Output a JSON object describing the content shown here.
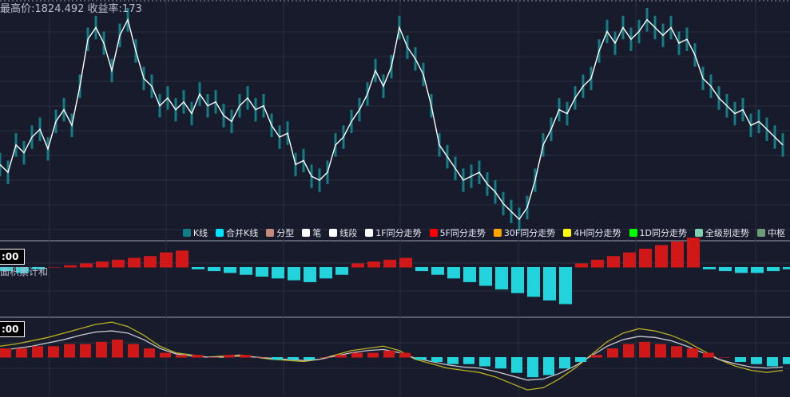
{
  "header": {
    "info_text": "最高价:1824.492 收益率:173"
  },
  "panels": {
    "macd_time": ":00",
    "macd_label": "面积累计和",
    "kdj_time": ":00"
  },
  "legend": [
    {
      "label": "K线",
      "color": "#127d86"
    },
    {
      "label": "合并K线",
      "color": "#00e5ff"
    },
    {
      "label": "分型",
      "color": "#c88a78"
    },
    {
      "label": "笔",
      "color": "#ffffff"
    },
    {
      "label": "线段",
      "color": "#ffffff"
    },
    {
      "label": "1F同分走势",
      "color": "#ffffff"
    },
    {
      "label": "5F同分走势",
      "color": "#ff0000"
    },
    {
      "label": "30F同分走势",
      "color": "#ffa500"
    },
    {
      "label": "4H同分走势",
      "color": "#ffff00"
    },
    {
      "label": "1D同分走势",
      "color": "#00ff00"
    },
    {
      "label": "全级别走势",
      "color": "#7fcfb0"
    },
    {
      "label": "中枢",
      "color": "#6f9a78"
    }
  ],
  "chart_data": [
    {
      "type": "line",
      "name": "price",
      "x": [
        0,
        10,
        20,
        30,
        40,
        50,
        60,
        70,
        80,
        90,
        100,
        110,
        120,
        130,
        140,
        150,
        160,
        170,
        180,
        190,
        200,
        210,
        220,
        230,
        240,
        250,
        260,
        270,
        280,
        290,
        300,
        310,
        320,
        330,
        340,
        350,
        360,
        370,
        380,
        390,
        400,
        410,
        420,
        430,
        440,
        450,
        460,
        470,
        480,
        490,
        500,
        510,
        520,
        530,
        540,
        550,
        560,
        570,
        580,
        590,
        600,
        610,
        620,
        630,
        640,
        650,
        660,
        670,
        680,
        690,
        700,
        710,
        720,
        730,
        740,
        750,
        760,
        770,
        780,
        790,
        800,
        810,
        820,
        830,
        840,
        850,
        860,
        870,
        880,
        890,
        900,
        910,
        920,
        930,
        940,
        950,
        960,
        970,
        980
      ],
      "values": [
        30,
        26,
        40,
        36,
        44,
        48,
        38,
        52,
        58,
        50,
        70,
        94,
        100,
        92,
        78,
        96,
        104,
        88,
        74,
        70,
        60,
        64,
        58,
        62,
        56,
        66,
        60,
        62,
        55,
        52,
        60,
        64,
        58,
        60,
        50,
        44,
        46,
        30,
        32,
        24,
        22,
        26,
        40,
        44,
        52,
        58,
        66,
        78,
        70,
        80,
        100,
        90,
        84,
        76,
        60,
        40,
        34,
        28,
        22,
        24,
        26,
        20,
        16,
        10,
        6,
        2,
        8,
        22,
        40,
        48,
        58,
        56,
        64,
        70,
        74,
        88,
        98,
        92,
        100,
        94,
        98,
        104,
        100,
        96,
        100,
        92,
        94,
        86,
        74,
        70,
        64,
        60,
        56,
        58,
        50,
        52,
        48,
        44,
        40
      ],
      "ylim": [
        0,
        110
      ],
      "grid": true
    },
    {
      "type": "bar",
      "name": "macd",
      "x": [
        0,
        20,
        40,
        60,
        80,
        100,
        120,
        140,
        160,
        180,
        200,
        220,
        240,
        260,
        280,
        300,
        320,
        340,
        360,
        380,
        400,
        420,
        440,
        460,
        480,
        500,
        520,
        540,
        560,
        580,
        600,
        620,
        640,
        660,
        680,
        700,
        720,
        740,
        760,
        780,
        800,
        820,
        840,
        860,
        880,
        900,
        920,
        940,
        960,
        980
      ],
      "values": [
        -2,
        -3,
        -1,
        0,
        1,
        2,
        3,
        4,
        5,
        6,
        8,
        9,
        -1,
        -2,
        -3,
        -4,
        -5,
        -6,
        -7,
        -8,
        -6,
        -4,
        2,
        3,
        4,
        5,
        -2,
        -4,
        -6,
        -8,
        -10,
        -12,
        -14,
        -16,
        -18,
        -20,
        2,
        4,
        6,
        8,
        10,
        12,
        14,
        16,
        -1,
        -2,
        -3,
        -3,
        -2,
        -1
      ],
      "ylim": [
        -20,
        20
      ]
    },
    {
      "type": "line",
      "name": "kdj",
      "x": [
        0,
        20,
        40,
        60,
        80,
        100,
        120,
        140,
        160,
        180,
        200,
        220,
        240,
        260,
        280,
        300,
        320,
        340,
        360,
        380,
        400,
        420,
        440,
        460,
        480,
        500,
        520,
        540,
        560,
        580,
        600,
        620,
        640,
        660,
        680,
        700,
        720,
        740,
        760,
        780,
        800,
        820,
        840,
        860,
        880,
        900,
        920,
        940,
        960,
        980
      ],
      "series": [
        {
          "values": [
            10,
            12,
            15,
            18,
            22,
            26,
            30,
            32,
            28,
            20,
            10,
            4,
            2,
            0,
            1,
            2,
            0,
            -2,
            -3,
            -4,
            -2,
            2,
            6,
            8,
            10,
            6,
            -2,
            -6,
            -10,
            -12,
            -14,
            -18,
            -24,
            -30,
            -28,
            -20,
            -10,
            2,
            14,
            22,
            26,
            24,
            20,
            14,
            6,
            -2,
            -8,
            -12,
            -14,
            -12
          ]
        },
        {
          "values": [
            6,
            8,
            10,
            13,
            16,
            20,
            23,
            24,
            22,
            16,
            8,
            3,
            1,
            0,
            0,
            1,
            0,
            -1,
            -2,
            -3,
            -2,
            1,
            4,
            6,
            7,
            4,
            -1,
            -4,
            -7,
            -9,
            -10,
            -13,
            -17,
            -21,
            -20,
            -15,
            -8,
            1,
            10,
            16,
            19,
            18,
            15,
            10,
            4,
            -2,
            -6,
            -9,
            -10,
            -9
          ]
        }
      ],
      "ylim": [
        -35,
        35
      ]
    }
  ]
}
